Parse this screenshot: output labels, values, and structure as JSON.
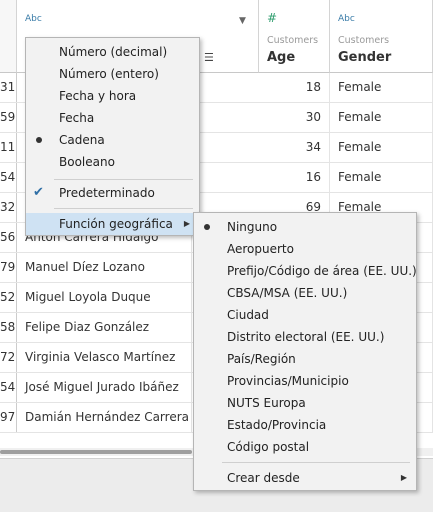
{
  "columns": {
    "name_type": "Abc",
    "age": {
      "type_icon": "#",
      "source": "Customers",
      "name": "Age"
    },
    "gender": {
      "type_icon": "Abc",
      "source": "Customers",
      "name": "Gender"
    }
  },
  "rows": [
    {
      "id": "31",
      "name": "",
      "age": "18",
      "gender": "Female"
    },
    {
      "id": "59",
      "name": "",
      "age": "30",
      "gender": "Female"
    },
    {
      "id": "11",
      "name": "",
      "age": "34",
      "gender": "Female"
    },
    {
      "id": "54",
      "name": "",
      "age": "16",
      "gender": "Female"
    },
    {
      "id": "32",
      "name": "",
      "age": "69",
      "gender": "Female"
    },
    {
      "id": "56",
      "name": "Anton Carrera Hidalgo",
      "age": "",
      "gender": ""
    },
    {
      "id": "79",
      "name": "Manuel Díez Lozano",
      "age": "",
      "gender": ""
    },
    {
      "id": "52",
      "name": "Miguel Loyola Duque",
      "age": "",
      "gender": ""
    },
    {
      "id": "58",
      "name": "Felipe Diaz González",
      "age": "",
      "gender": ""
    },
    {
      "id": "72",
      "name": "Virginia Velasco Martínez",
      "age": "",
      "gender": ""
    },
    {
      "id": "54",
      "name": "José Miguel Jurado Ibáñez",
      "age": "",
      "gender": ""
    },
    {
      "id": "97",
      "name": "Damián Hernández Carrera",
      "age": "",
      "gender": ""
    }
  ],
  "type_menu": {
    "items": [
      "Número (decimal)",
      "Número (entero)",
      "Fecha y hora",
      "Fecha",
      "Cadena",
      "Booleano"
    ],
    "selected_index": 4,
    "default_label": "Predeterminado",
    "geo_label": "Función geográfica"
  },
  "geo_menu": {
    "items": [
      "Ninguno",
      "Aeropuerto",
      "Prefijo/Código de área (EE. UU.)",
      "CBSA/MSA (EE. UU.)",
      "Ciudad",
      "Distrito electoral (EE. UU.)",
      "País/Región",
      "Provincias/Municipio",
      "NUTS Europa",
      "Estado/Provincia",
      "Código postal"
    ],
    "selected_index": 0,
    "create_from": "Crear desde"
  },
  "colors": {
    "highlight": "#cfe2f3",
    "type_text": "#3a7ca8",
    "numeric_type": "#2e9d6e"
  }
}
